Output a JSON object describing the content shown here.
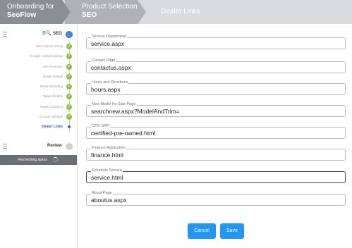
{
  "breadcrumb": {
    "steps": [
      {
        "line1": "Onboarding for",
        "line2": "SeoFlow"
      },
      {
        "line1": "Product Selection",
        "line2": "SEO"
      },
      {
        "line1": "Dealer Links"
      }
    ]
  },
  "sidebar": {
    "section_title": "SEO",
    "steps": [
      {
        "label": "Site Analysis Setup",
        "state": "complete"
      },
      {
        "label": "Google Analytics Setup",
        "state": "complete"
      },
      {
        "label": "Site Providers",
        "state": "complete"
      },
      {
        "label": "Dealer Details",
        "state": "complete"
      },
      {
        "label": "Dealer Branding",
        "state": "complete"
      },
      {
        "label": "Target Models",
        "state": "complete"
      },
      {
        "label": "Target Locations",
        "state": "complete"
      },
      {
        "label": "Account Settings",
        "state": "complete"
      },
      {
        "label": "Dealer Links",
        "state": "active"
      }
    ],
    "review_label": "Review",
    "status_text": "Rechecking status"
  },
  "form": {
    "fields": [
      {
        "label": "Service Department",
        "value": "service.aspx"
      },
      {
        "label": "Contact Page",
        "value": "contactus.aspx"
      },
      {
        "label": "Hours and Directions",
        "value": "hours.aspx"
      },
      {
        "label": "New Model for Sale Page",
        "value": "searchnew.aspx?ModelAndTrim="
      },
      {
        "label": "CPO SRP",
        "value": "certified-pre-owned.html"
      },
      {
        "label": "Finance Application",
        "value": "finance.html"
      },
      {
        "label": "Schedule Service",
        "value": "service.html"
      },
      {
        "label": "About Page",
        "value": "aboutus.aspx"
      }
    ],
    "cancel_label": "Cancel",
    "save_label": "Save"
  },
  "colors": {
    "accent": "#2196f3",
    "complete": "#8bc34a",
    "breadcrumb_bg": "#d4d6d9",
    "status_bar": "#6b7077"
  }
}
